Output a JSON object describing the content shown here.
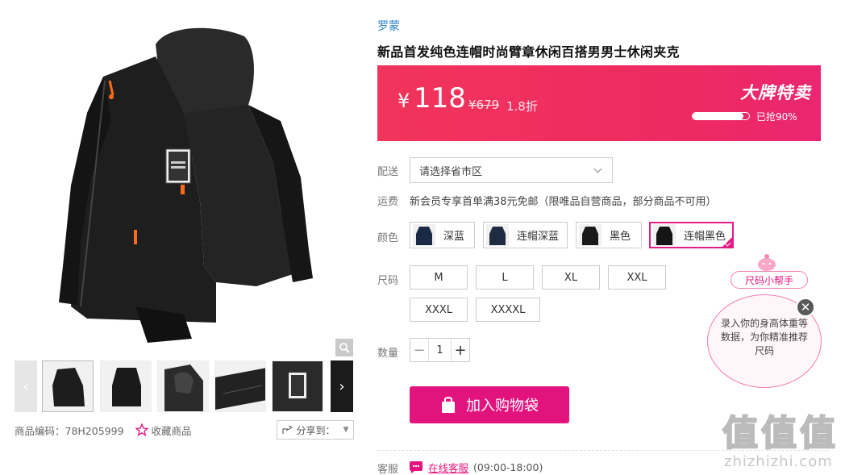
{
  "product": {
    "brand": "罗蒙",
    "title": "新品首发纯色连帽时尚臂章休闲百搭男男士休闲夹克",
    "sku_label": "商品编码：78H205999",
    "favorite_label": "收藏商品",
    "share_label": "分享到："
  },
  "price": {
    "currency": "¥",
    "current": "118",
    "original": "¥679",
    "discount": "1.8折",
    "flash_title": "大牌特卖",
    "sold_progress": 0.9,
    "sold_text": "已抢90%"
  },
  "delivery": {
    "label": "配送",
    "placeholder": "请选择省市区"
  },
  "shipping": {
    "label": "运费",
    "text": "新会员专享首单满38元免邮（限唯品自营商品，部分商品不可用）"
  },
  "colors": {
    "label": "颜色",
    "options": [
      "深蓝",
      "连帽深蓝",
      "黑色",
      "连帽黑色"
    ],
    "selected": "连帽黑色"
  },
  "sizes": {
    "label": "尺码",
    "options": [
      "M",
      "L",
      "XL",
      "XXL",
      "XXXL",
      "XXXXL"
    ]
  },
  "quantity": {
    "label": "数量",
    "value": "1",
    "minus": "−",
    "plus": "+"
  },
  "cart": {
    "label": "加入购物袋"
  },
  "service": {
    "label": "客服",
    "link_text": "在线客服",
    "hours": "(09:00-18:00)"
  },
  "size_helper": {
    "title": "尺码小帮手",
    "text": "录入你的身高体重等数据，为你精准推荐尺码",
    "close": "✕"
  },
  "watermark": {
    "logo": [
      "值",
      "值",
      "值"
    ],
    "text": "zhizhizhi.com"
  },
  "colors_theme": {
    "accent": "#e3137d",
    "price_bar": "#ef2d5e",
    "brand_link": "#2a84c9"
  }
}
